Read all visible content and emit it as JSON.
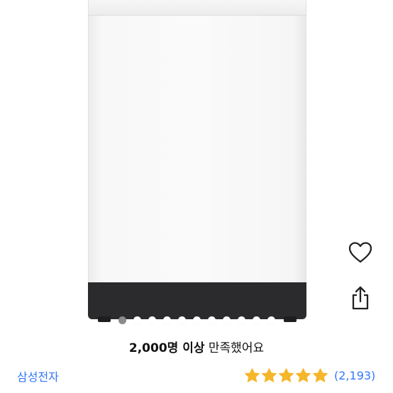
{
  "product": {
    "image_alt": "top-load washing machine",
    "carousel": {
      "total": 11,
      "active": 0
    }
  },
  "actions": {
    "wishlist_icon": "heart-outline-icon",
    "share_icon": "share-icon"
  },
  "satisfaction": {
    "count_text": "2,000명 이상",
    "suffix_text": " 만족했어요"
  },
  "brand": {
    "name": "삼성전자"
  },
  "rating": {
    "stars": 5,
    "star_color": "#f5b62a",
    "review_count": "(2,193)"
  },
  "colors": {
    "link": "#3478f6"
  }
}
